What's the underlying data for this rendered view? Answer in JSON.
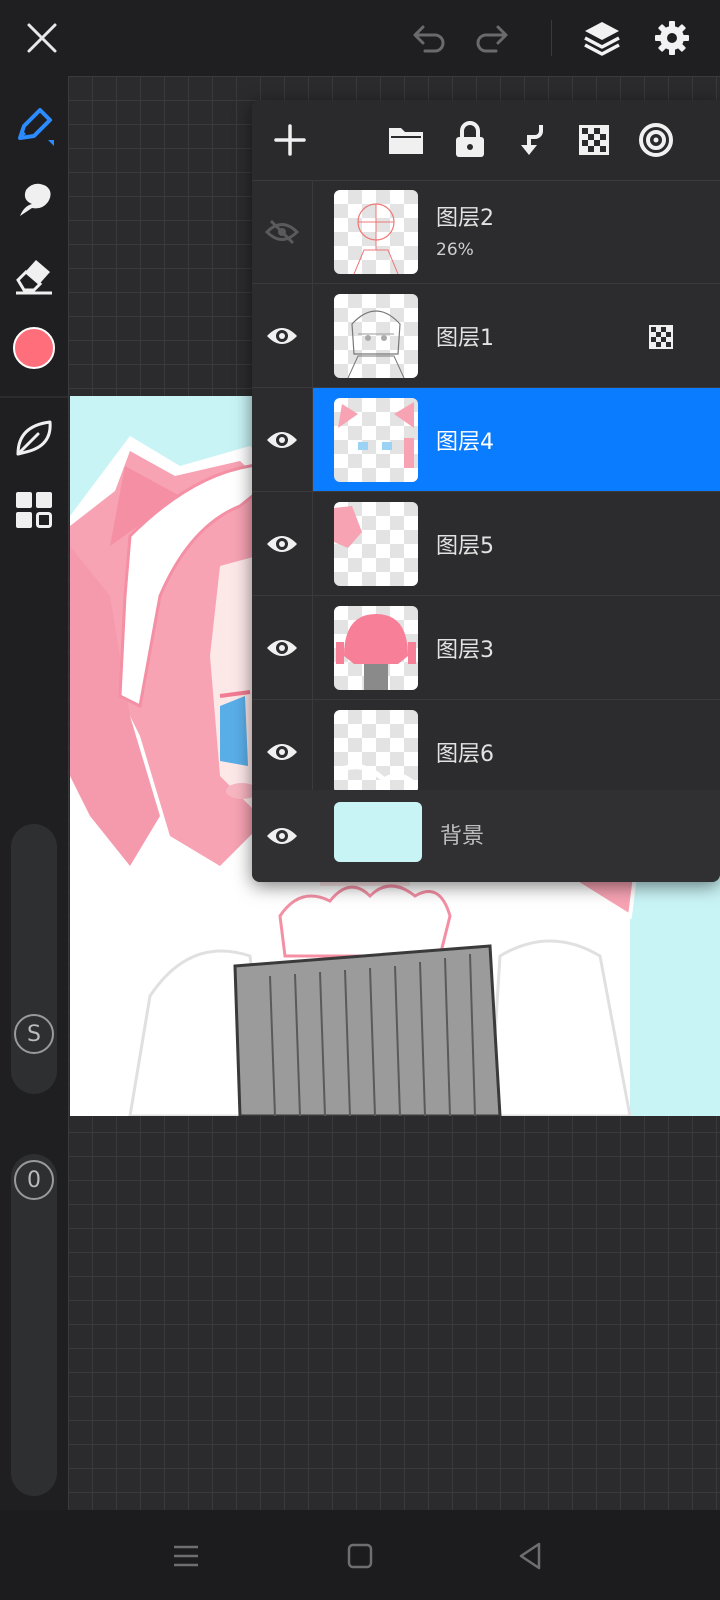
{
  "topbar": {
    "close_icon": "close-icon",
    "undo_icon": "undo-icon",
    "redo_icon": "redo-icon",
    "layers_icon": "layers-icon",
    "settings_icon": "gear-icon"
  },
  "tools": {
    "items": [
      "pen-icon",
      "smudge-icon",
      "eraser-icon",
      "color-swatch",
      "leaf-icon",
      "grid-icon"
    ],
    "current_color": "#ff6f7b",
    "size_slider_label": "S",
    "opacity_slider_label": "0"
  },
  "layers": {
    "toolbar": [
      "add-icon",
      "folder-icon",
      "lock-icon",
      "merge-down-icon",
      "checker-icon",
      "target-icon"
    ],
    "items": [
      {
        "name": "图层2",
        "opacity": "26%",
        "visible": false,
        "selected": false,
        "clipping": false
      },
      {
        "name": "图层1",
        "opacity": "",
        "visible": true,
        "selected": false,
        "clipping": true
      },
      {
        "name": "图层4",
        "opacity": "",
        "visible": true,
        "selected": true,
        "clipping": false
      },
      {
        "name": "图层5",
        "opacity": "",
        "visible": true,
        "selected": false,
        "clipping": false
      },
      {
        "name": "图层3",
        "opacity": "",
        "visible": true,
        "selected": false,
        "clipping": false
      },
      {
        "name": "图层6",
        "opacity": "",
        "visible": true,
        "selected": false,
        "clipping": false
      }
    ],
    "background": {
      "name": "背景",
      "color": "#c9f4f6",
      "visible": true
    }
  },
  "colors": {
    "accent": "#0a7cff",
    "canvas_bg": "#c9f4f6",
    "hair_pink": "#f7a3b4"
  },
  "navbar": [
    "menu-icon",
    "home-icon",
    "back-icon"
  ]
}
